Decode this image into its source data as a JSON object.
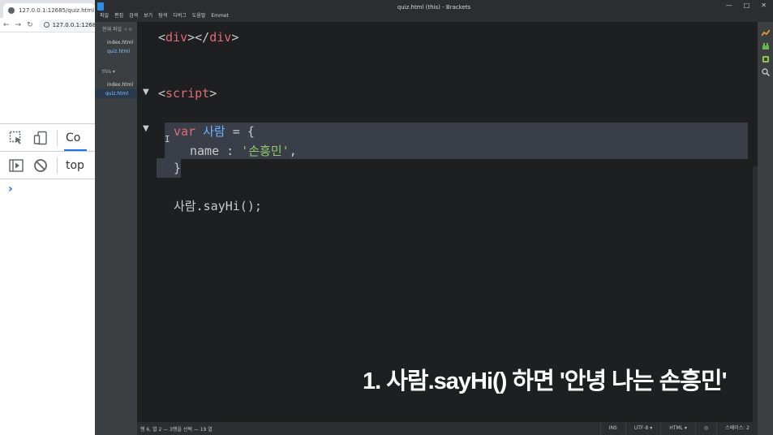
{
  "browser": {
    "tab_title": "127.0.0.1:12685/quiz.html",
    "address": "127.0.0.1:12685",
    "devtools": {
      "tab_label": "Co",
      "context": "top",
      "prompt": "›"
    }
  },
  "brackets": {
    "window_title": "quiz.html (this) - Brackets",
    "window_controls": [
      "—",
      "□",
      "✕"
    ],
    "menu": [
      "파일",
      "편집",
      "검색",
      "보기",
      "탐색",
      "디버그",
      "도움말",
      "Emmet"
    ],
    "sidebar": {
      "working_files_title": "현재 파일",
      "working_files_chip": "⟳ ⚙",
      "working_files": [
        "index.html",
        "quiz.html"
      ],
      "project_title": "this ▾",
      "project_files": [
        "index.html",
        "quiz.html"
      ]
    },
    "code": {
      "line1": {
        "open": "<",
        "tag1": "div",
        "mid": "></",
        "tag2": "div",
        "close": ">"
      },
      "line2": {
        "open": "<",
        "tag": "script",
        "close": ">"
      },
      "line3": {
        "kw": "var",
        "name": "사람",
        "rest": " = {"
      },
      "line4": {
        "key": "name : ",
        "str": "'손흥민'",
        "rest": ","
      },
      "line5": "}",
      "line6": "사람.sayHi();",
      "fold_marker": "▼",
      "cursor": "I"
    },
    "caption": "1. 사람.sayHi() 하면 '안녕 나는 손흥민'",
    "status": {
      "position": "행 6, 열 2 — 3행을 선택 — 19 열",
      "ins": "INS",
      "encoding": "UTF-8 ▾",
      "language": "HTML ▾",
      "indent": "스페이스: 2"
    }
  },
  "colors": {
    "editor_bg": "#1d1f21",
    "selection": "#3a3e48",
    "tag": "#e06c75",
    "variable": "#6cb6ff",
    "string": "#8dc96b",
    "devtools_accent": "#1a73e8"
  }
}
